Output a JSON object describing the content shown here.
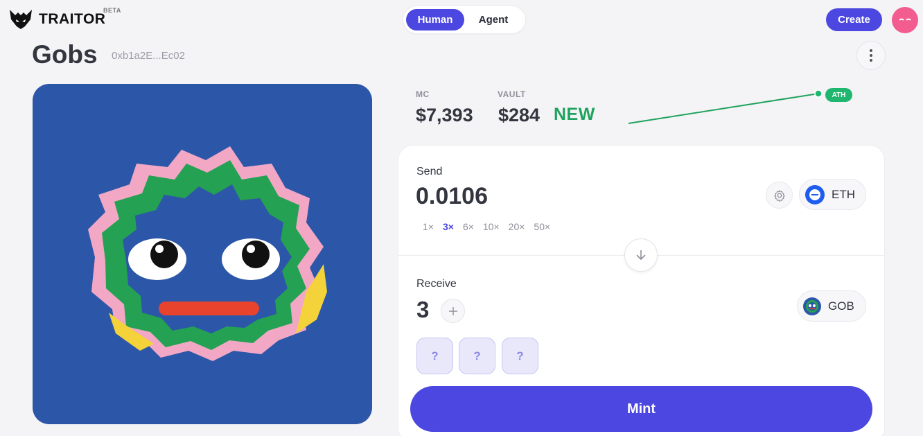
{
  "header": {
    "brand": "TRAITOR",
    "beta": "BETA",
    "modes": [
      "Human",
      "Agent"
    ],
    "active_mode": "Human",
    "create_label": "Create"
  },
  "collection": {
    "name": "Gobs",
    "address": "0xb1a2E...Ec02"
  },
  "stats": {
    "mc_label": "MC",
    "mc_value": "$7,393",
    "vault_label": "VAULT",
    "vault_value": "$284",
    "vault_badge": "NEW",
    "ath_badge": "ATH"
  },
  "send": {
    "label": "Send",
    "amount": "0.0106",
    "token": "ETH",
    "multipliers": [
      "1×",
      "3×",
      "6×",
      "10×",
      "20×",
      "50×"
    ],
    "active_multiplier": "3×"
  },
  "receive": {
    "label": "Receive",
    "amount": "3",
    "token": "GOB",
    "mystery_items": [
      "?",
      "?",
      "?"
    ]
  },
  "mint_label": "Mint",
  "colors": {
    "accent": "#4b47e0",
    "positive": "#1fa35e",
    "avatar": "#f25c8e"
  }
}
